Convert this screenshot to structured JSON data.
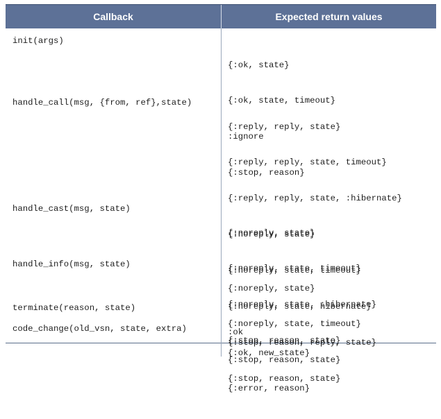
{
  "header": {
    "callback": "Callback",
    "returns": "Expected return values"
  },
  "rows": [
    {
      "callback": "init(args)",
      "returns": [
        "{:ok, state}",
        "{:ok, state, timeout}",
        ":ignore",
        "{:stop, reason}"
      ]
    },
    {
      "callback": "handle_call(msg, {from, ref},state)",
      "returns": [
        "{:reply, reply, state}",
        "{:reply, reply, state, timeout}",
        "{:reply, reply, state, :hibernate}",
        "{:noreply, state}",
        "{:noreply, state, timeout}",
        "{:noreply, state, hibernate}",
        "{:stop, reason, reply, state}",
        "{:stop, reason, state}"
      ]
    },
    {
      "callback": "handle_cast(msg, state)",
      "returns": [
        "{:noreply, state}",
        "{:noreply, state, timeout}",
        "{:noreply, state, :hibernate}",
        "{:stop, reason, state}"
      ]
    },
    {
      "callback": "handle_info(msg, state)",
      "returns": [
        "{:noreply, state}",
        "{:noreply, state, timeout}",
        "{:stop, reason, state}"
      ]
    },
    {
      "callback": "terminate(reason, state)",
      "returns": [
        ":ok"
      ]
    },
    {
      "callback": "code_change(old_vsn, state, extra)",
      "returns": [
        "{:ok, new_state}",
        "{:error, reason}"
      ]
    }
  ]
}
